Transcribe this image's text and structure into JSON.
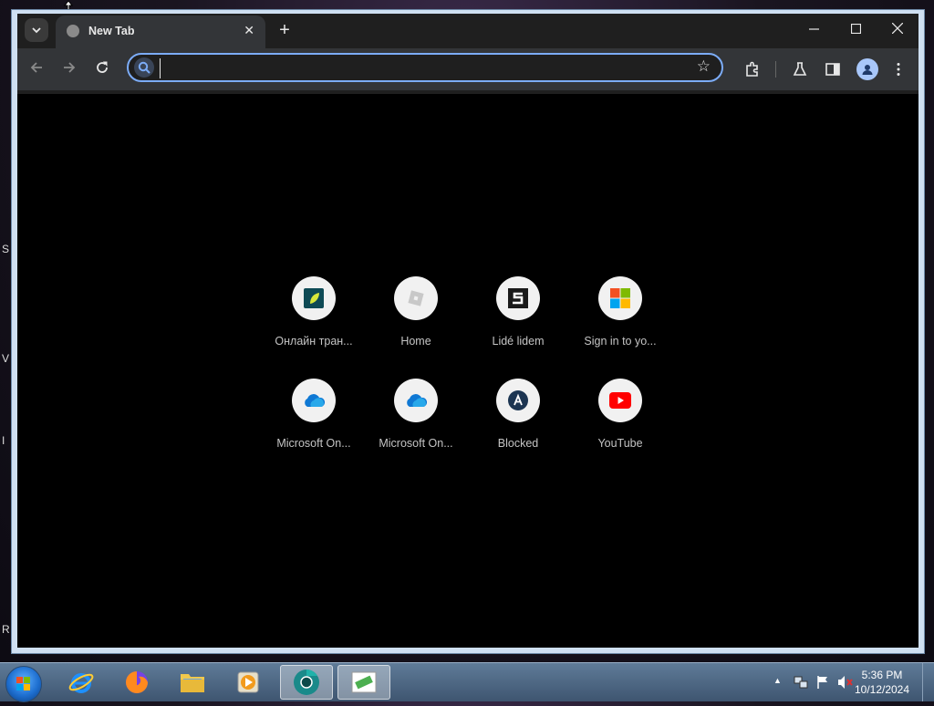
{
  "window": {
    "tab_title": "New Tab",
    "omnibox_value": "",
    "omnibox_placeholder": ""
  },
  "shortcuts": [
    {
      "label": "Онлайн тран...",
      "icon": "green-leaf-app-icon"
    },
    {
      "label": "Home",
      "icon": "roblox-icon"
    },
    {
      "label": "Lidé lidem",
      "icon": "s-logo-icon"
    },
    {
      "label": "Sign in to yo...",
      "icon": "microsoft-icon"
    },
    {
      "label": "Microsoft On...",
      "icon": "onedrive-icon"
    },
    {
      "label": "Microsoft On...",
      "icon": "onedrive-icon"
    },
    {
      "label": "Blocked",
      "icon": "a-badge-icon"
    },
    {
      "label": "YouTube",
      "icon": "youtube-icon"
    }
  ],
  "taskbar": {
    "time": "5:36 PM",
    "date": "10/12/2024",
    "apps": [
      "internet-explorer-icon",
      "firefox-icon",
      "file-explorer-icon",
      "media-player-icon",
      "chrome-icon",
      "green-card-app-icon"
    ]
  },
  "desktop": {
    "edge_letters": [
      "S",
      "V",
      "I",
      "R"
    ]
  },
  "colors": {
    "accent": "#7cacf8",
    "toolbar": "#333538",
    "tabstrip": "#1f1f1f",
    "content_bg": "#000000"
  }
}
